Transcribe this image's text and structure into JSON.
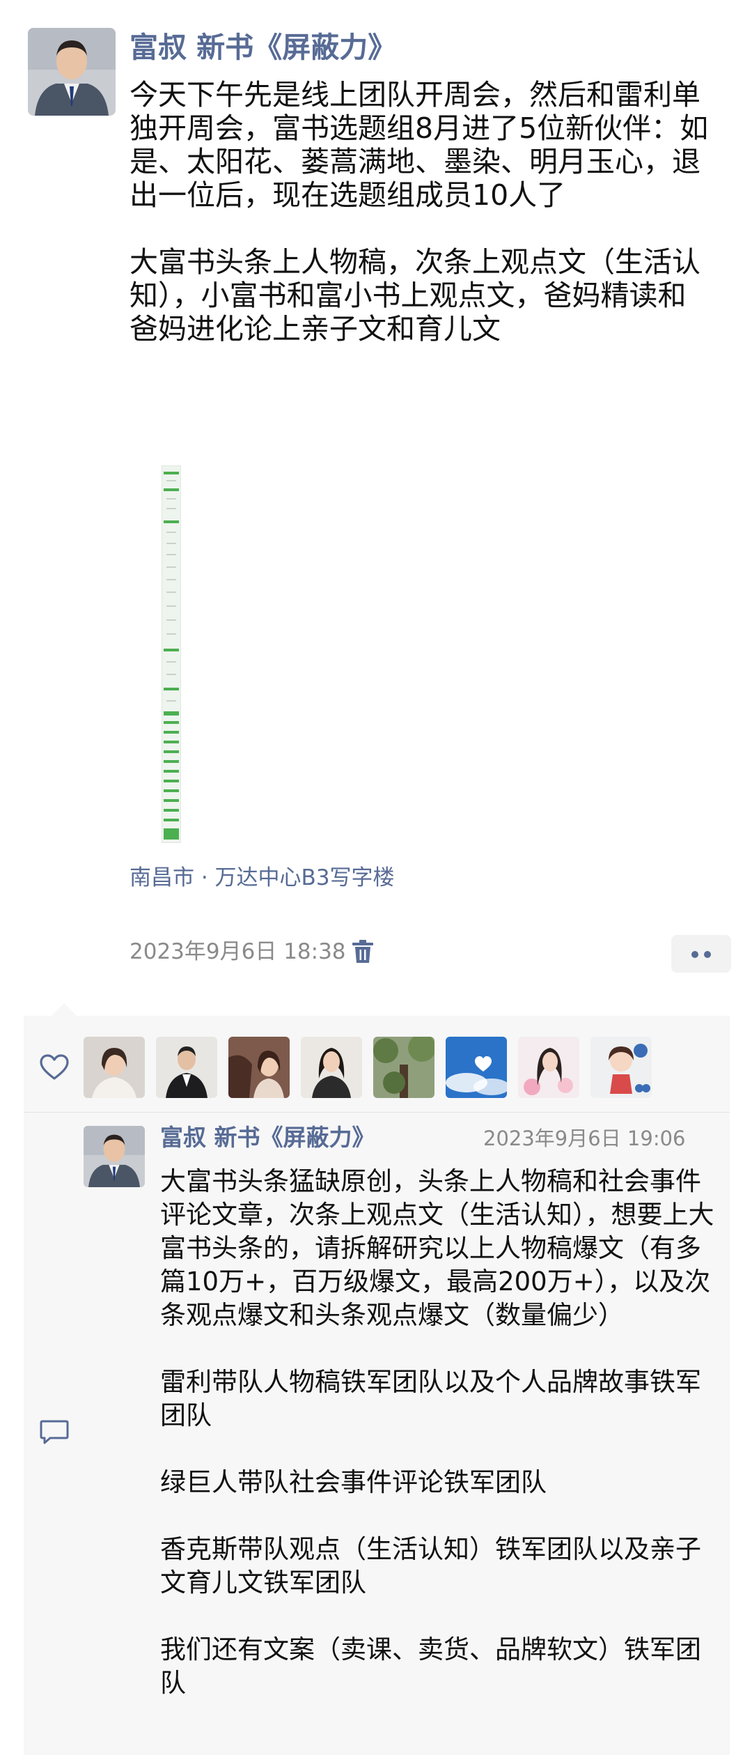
{
  "post": {
    "author_name": "富叔 新书《屏蔽力》",
    "avatar_icon": "man-in-suit-avatar",
    "text": "今天下午先是线上团队开周会，然后和雷利单独开周会，富书选题组8月进了5位新伙伴：如是、太阳花、蒌蒿满地、墨染、明月玉心，退出一位后，现在选题组成员10人了\n\n大富书头条上人物稿，次条上观点文（生活认知），小富书和富小书上观点文，爸妈精读和爸妈进化论上亲子文和育儿文",
    "location": "南昌市 · 万达中心B3写字楼",
    "timestamp": "2023年9月6日 18:38",
    "delete_icon": "trash-icon",
    "more_icon": "two-dots-icon"
  },
  "interactions": {
    "like_icon": "heart-outline-icon",
    "likers": [
      {
        "icon": "avatar-woman-white-shirt"
      },
      {
        "icon": "avatar-man-black-suit"
      },
      {
        "icon": "avatar-woman-with-horse"
      },
      {
        "icon": "avatar-woman-dark-hair"
      },
      {
        "icon": "avatar-outdoor-trees"
      },
      {
        "icon": "avatar-blue-sky-heart"
      },
      {
        "icon": "avatar-woman-flowers"
      },
      {
        "icon": "avatar-cartoon-girl"
      }
    ],
    "comment_icon": "comment-bubble-icon",
    "comment": {
      "author_name": "富叔 新书《屏蔽力》",
      "timestamp": "2023年9月6日 19:06",
      "text": "大富书头条猛缺原创，头条上人物稿和社会事件评论文章，次条上观点文（生活认知），想要上大富书头条的，请拆解研究以上人物稿爆文（有多篇10万+，百万级爆文，最高200万+），以及次条观点爆文和头条观点爆文（数量偏少）\n\n雷利带队人物稿铁军团队以及个人品牌故事铁军团队\n\n绿巨人带队社会事件评论铁军团队\n\n香克斯带队观点（生活认知）铁军团队以及亲子文育儿文铁军团队\n\n我们还有文案（卖课、卖货、品牌软文）铁军团队"
    }
  },
  "colors": {
    "link_blue": "#576b95",
    "text_main": "#111111",
    "text_muted": "#8a8a8a",
    "panel_bg": "#f7f7f7"
  }
}
